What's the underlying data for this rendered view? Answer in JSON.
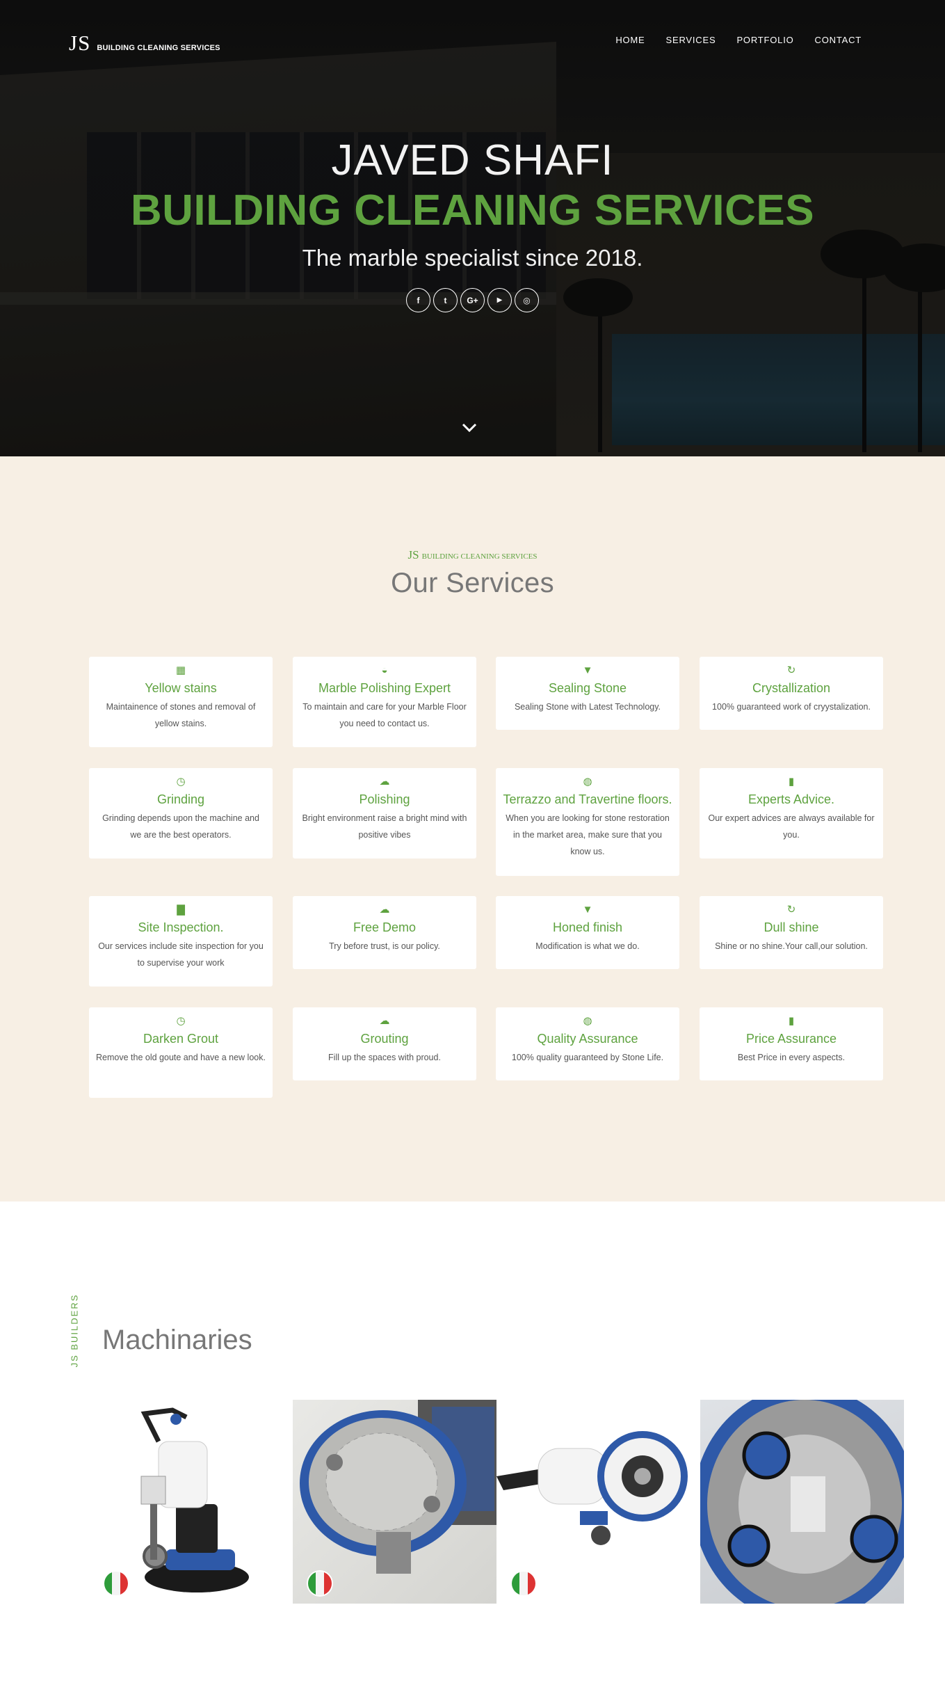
{
  "header": {
    "logo_mark": "JS",
    "logo_text": "BUILDING CLEANING SERVICES",
    "nav": [
      "HOME",
      "SERVICES",
      "PORTFOLIO",
      "CONTACT"
    ]
  },
  "hero": {
    "line1": "JAVED SHAFI",
    "line2": "BUILDING CLEANING SERVICES",
    "line3": "The marble specialist since 2018.",
    "socials": [
      {
        "icon": "facebook-icon",
        "glyph": "f"
      },
      {
        "icon": "twitter-icon",
        "glyph": "t"
      },
      {
        "icon": "google-plus-icon",
        "glyph": "G+"
      },
      {
        "icon": "youtube-icon",
        "glyph": "▶"
      },
      {
        "icon": "instagram-icon",
        "glyph": "◎"
      }
    ],
    "scroll_icon": "chevron-down-icon"
  },
  "services": {
    "subtitle_mark": "JS",
    "subtitle_text": "BUILDING CLEANING SERVICES",
    "title": "Our Services",
    "items": [
      {
        "icon": "grid-icon",
        "glyph": "▦",
        "title": "Yellow stains",
        "desc": "Maintainence of stones and removal of yellow stains."
      },
      {
        "icon": "shield-icon",
        "glyph": "◒",
        "title": "Marble Polishing Expert",
        "desc": "To maintain and care for your Marble Floor you need to contact us."
      },
      {
        "icon": "bookmark-icon",
        "glyph": "▼",
        "title": "Sealing Stone",
        "desc": "Sealing Stone with Latest Technology."
      },
      {
        "icon": "refresh-icon",
        "glyph": "↻",
        "title": "Crystallization",
        "desc": "100% guaranteed work of cryystalization."
      },
      {
        "icon": "clock-icon",
        "glyph": "◷",
        "title": "Grinding",
        "desc": "Grinding depends upon the machine and we are the best operators."
      },
      {
        "icon": "cloud-icon",
        "glyph": "☁",
        "title": "Polishing",
        "desc": "Bright environment raise a bright mind with positive vibes"
      },
      {
        "icon": "globe-icon",
        "glyph": "◍",
        "title": "Terrazzo and Travertine floors.",
        "desc": "When you are looking for stone restoration in the market area, make sure that you know us."
      },
      {
        "icon": "tablet-icon",
        "glyph": "▮",
        "title": "Experts Advice.",
        "desc": "Our expert advices are always available for you."
      },
      {
        "icon": "bar-chart-icon",
        "glyph": "▇",
        "title": "Site Inspection.",
        "desc": "Our services include site inspection for you to supervise your work"
      },
      {
        "icon": "cloud-upload-icon",
        "glyph": "☁",
        "title": "Free Demo",
        "desc": "Try before trust, is our policy."
      },
      {
        "icon": "bookmark-icon",
        "glyph": "▼",
        "title": "Honed finish",
        "desc": "Modification is what we do."
      },
      {
        "icon": "refresh-icon",
        "glyph": "↻",
        "title": "Dull shine",
        "desc": "Shine or no shine.Your call,our solution."
      },
      {
        "icon": "clock-icon",
        "glyph": "◷",
        "title": "Darken Grout",
        "desc": "Remove the old goute and have a new look."
      },
      {
        "icon": "cloud-icon",
        "glyph": "☁",
        "title": "Grouting",
        "desc": "Fill up the spaces with proud."
      },
      {
        "icon": "globe-icon",
        "glyph": "◍",
        "title": "Quality Assurance",
        "desc": "100% quality guaranteed by Stone Life."
      },
      {
        "icon": "tablet-icon",
        "glyph": "▮",
        "title": "Price Assurance",
        "desc": "Best Price in every aspects."
      }
    ]
  },
  "machinaries": {
    "vertical_label": "JS   BUILDERS",
    "title": "Machinaries",
    "images": [
      {
        "name": "floor-grinder-machine-image",
        "flag": "italy-flag-icon"
      },
      {
        "name": "grinding-disc-closeup-image",
        "flag": "italy-flag-icon"
      },
      {
        "name": "scrubber-machine-image",
        "flag": "italy-flag-icon"
      },
      {
        "name": "blue-grinder-heads-image",
        "flag": "italy-flag-icon"
      }
    ]
  }
}
